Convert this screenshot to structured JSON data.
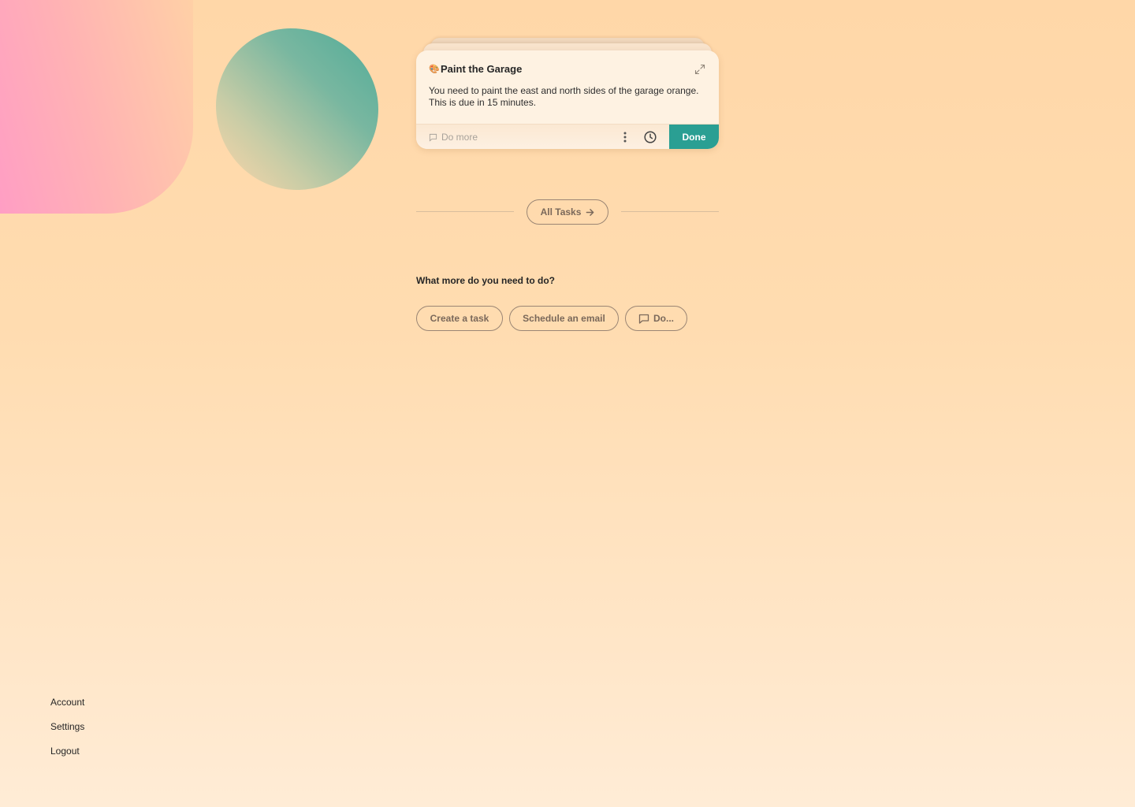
{
  "task_card": {
    "emoji": "🎨",
    "title": "Paint the Garage",
    "description": "You need to paint the east and north sides of the garage orange. This is due in 15 minutes.",
    "do_more_placeholder": "Do more",
    "done_label": "Done",
    "icons": [
      "expand-icon",
      "chat-bubble-icon",
      "more-vertical-icon",
      "clock-icon"
    ]
  },
  "all_tasks": {
    "label": "All Tasks",
    "icon": "arrow-right-icon"
  },
  "suggestions": {
    "heading": "What more do you need to do?",
    "chips": [
      {
        "label": "Create a task"
      },
      {
        "label": "Schedule an email"
      },
      {
        "label": "Do...",
        "icon": "chat-bubble-icon"
      }
    ]
  },
  "nav": {
    "items": [
      "Account",
      "Settings",
      "Logout"
    ]
  },
  "colors": {
    "accent": "#2a9f93",
    "background": "#ffd7a8",
    "card": "#fef2e2",
    "chip_border": "#9a8574"
  }
}
